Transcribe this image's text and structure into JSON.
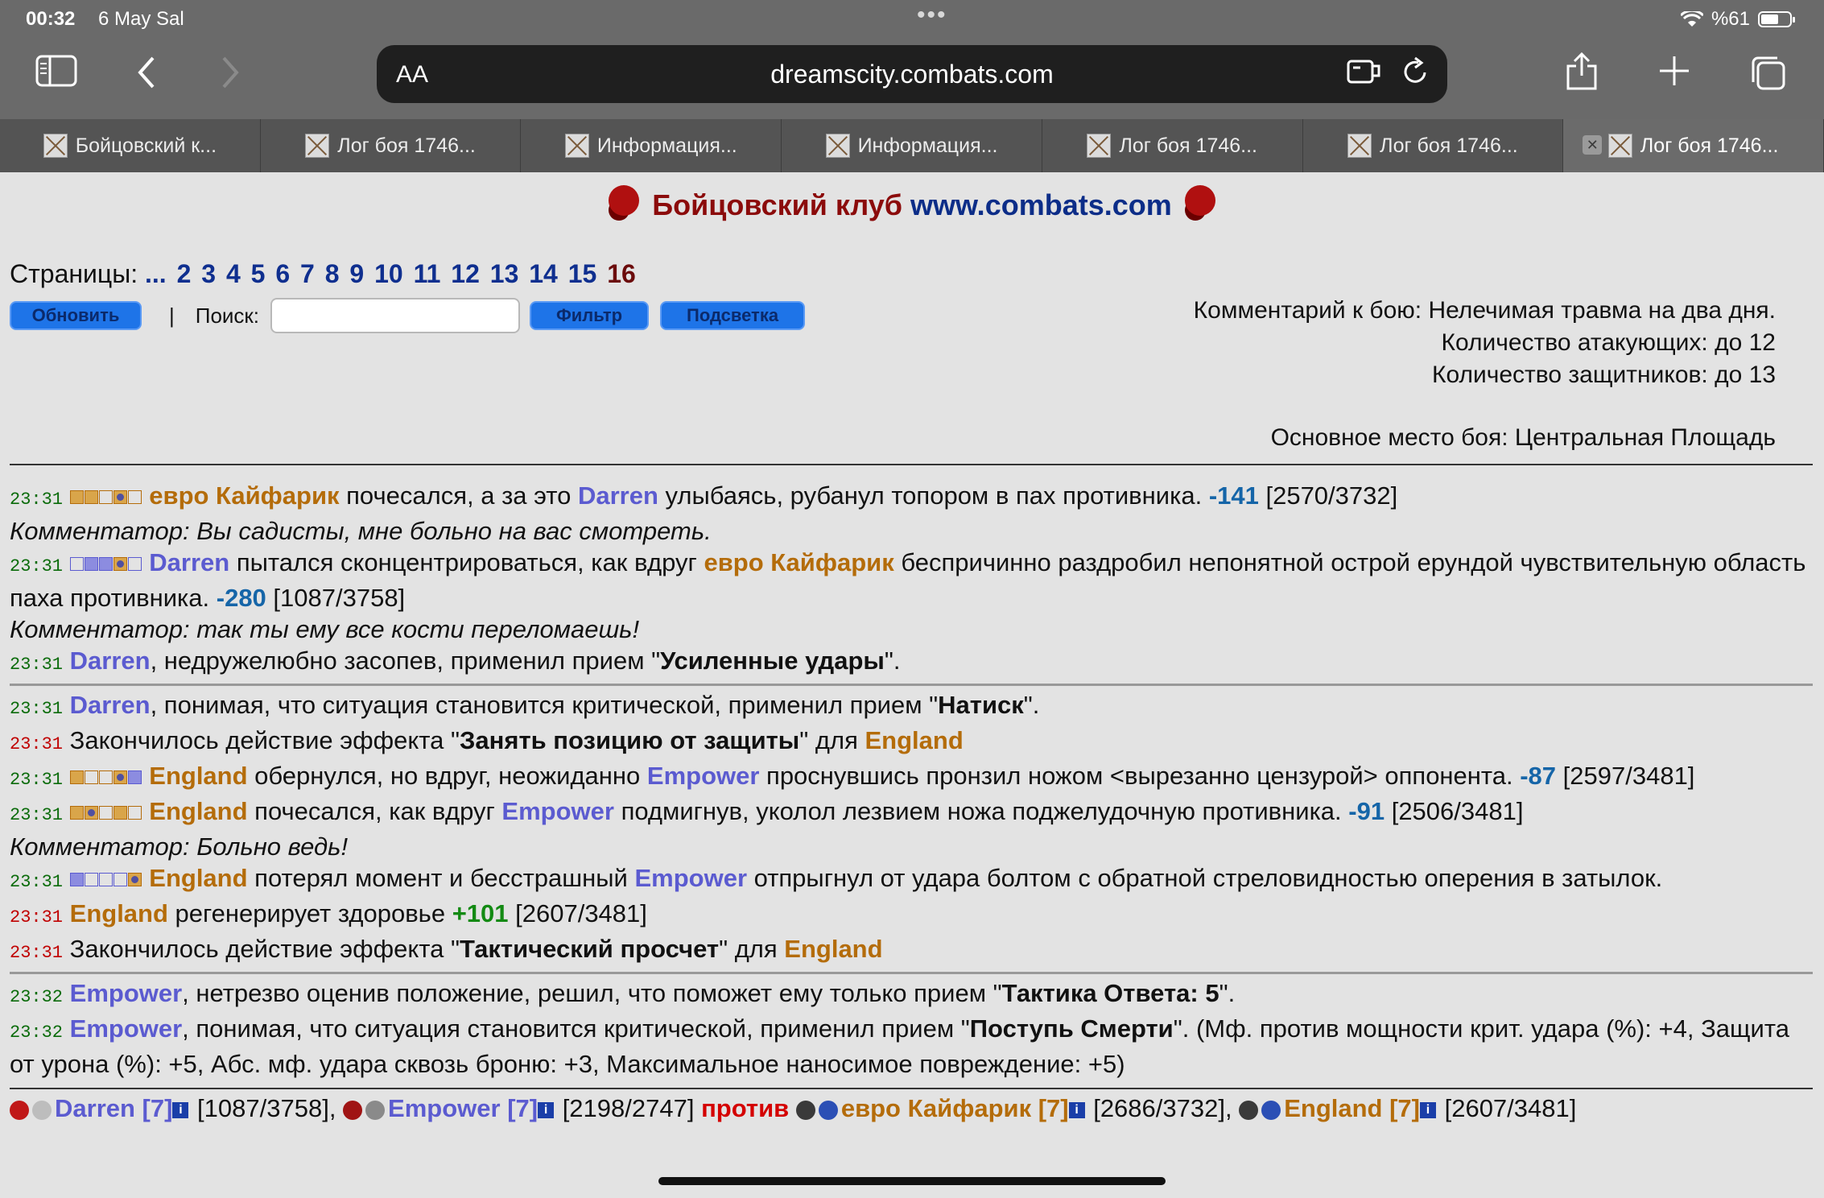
{
  "status": {
    "time": "00:32",
    "date": "6 May Sal",
    "battery": "%61",
    "battery_level": 0.61
  },
  "toolbar": {
    "aa": "AA",
    "url": "dreamscity.combats.com"
  },
  "tabs": [
    "Бойцовский к...",
    "Лог боя 1746...",
    "Информация...",
    "Информация...",
    "Лог боя 1746...",
    "Лог боя 1746...",
    "Лог боя 1746..."
  ],
  "header": {
    "club": "Бойцовский клуб",
    "site": "www.combats.com"
  },
  "pages": {
    "label": "Страницы:",
    "items": [
      "...",
      "2",
      "3",
      "4",
      "5",
      "6",
      "7",
      "8",
      "9",
      "10",
      "11",
      "12",
      "13",
      "14",
      "15"
    ],
    "current": "16"
  },
  "controls": {
    "refresh": "Обновить",
    "divider": "|",
    "search_label": "Поиск:",
    "filter": "Фильтр",
    "highlight": "Подсветка"
  },
  "meta": {
    "comment": "Комментарий к бою: Нелечимая травма на два дня.",
    "attackers": "Количество атакующих: до 12",
    "defenders": "Количество защитников: до 13",
    "location": "Основное место боя: Центральная Площадь"
  },
  "log": {
    "l1": {
      "time": "23:31",
      "a": "евро Кайфарик",
      "t1": " почесался, а за это ",
      "b": "Darren",
      "t2": " улыбаясь, рубанул топором в пах противника. ",
      "dmg": "-141",
      "hp": " [2570/3732]"
    },
    "c1": "Комментатор: Вы садисты, мне больно на вас смотреть.",
    "l2": {
      "time": "23:31",
      "a": "Darren",
      "t1": " пытался сконцентрироваться, как вдруг ",
      "b": "евро Кайфарик",
      "t2": " беспричинно раздробил непонятной острой ерундой чувствительную область паха противника. ",
      "dmg": "-280",
      "hp": " [1087/3758]"
    },
    "c2": "Комментатор: так ты ему все кости переломаешь!",
    "l3": {
      "time": "23:31",
      "a": "Darren",
      "t1": ", недружелюбно засопев, применил прием \"",
      "skill": "Усиленные удары",
      "t2": "\"."
    },
    "l4": {
      "time": "23:31",
      "a": "Darren",
      "t1": ", понимая, что ситуация становится критической, применил прием \"",
      "skill": "Натиск",
      "t2": "\"."
    },
    "l5": {
      "time": "23:31",
      "t1": "Закончилось действие эффекта \"",
      "skill": "Занять позицию от защиты",
      "t2": "\" для ",
      "a": "England"
    },
    "l6": {
      "time": "23:31",
      "a": "England",
      "t1": " обернулся, но вдруг, неожиданно ",
      "b": "Empower",
      "t2": " проснувшись пронзил ножом <вырезанно цензурой> оппонента. ",
      "dmg": "-87",
      "hp": " [2597/3481]"
    },
    "l7": {
      "time": "23:31",
      "a": "England",
      "t1": " почесался, как вдруг ",
      "b": "Empower",
      "t2": " подмигнув, уколол лезвием ножа поджелудочную противника. ",
      "dmg": "-91",
      "hp": " [2506/3481]"
    },
    "c3": "Комментатор: Больно ведь!",
    "l8": {
      "time": "23:31",
      "a": "England",
      "t1": " потерял момент и бесстрашный ",
      "b": "Empower",
      "t2": " отпрыгнул от удара болтом с обратной стреловидностью оперения в затылок."
    },
    "l9": {
      "time": "23:31",
      "a": "England",
      "t1": " регенерирует здоровье ",
      "heal": "+101",
      "hp": " [2607/3481]"
    },
    "l10": {
      "time": "23:31",
      "t1": "Закончилось действие эффекта \"",
      "skill": "Тактический просчет",
      "t2": "\" для ",
      "a": "England"
    },
    "l11": {
      "time": "23:32",
      "a": "Empower",
      "t1": ", нетрезво оценив положение, решил, что поможет ему только прием \"",
      "skill": "Тактика Ответа: 5",
      "t2": "\"."
    },
    "l12": {
      "time": "23:32",
      "a": "Empower",
      "t1": ", понимая, что ситуация становится критической, применил прием \"",
      "skill": "Поступь Смерти",
      "t2": "\". (Мф. против мощности крит. удара (%): +4, Защита от урона (%): +5, Абс. мф. удара сквозь броню: +3, Максимальное наносимое повреждение: +5)"
    }
  },
  "summary": {
    "p1": "Darren [7]",
    "p1hp": " [1087/3758], ",
    "p2": "Empower [7]",
    "p2hp": " [2198/2747] ",
    "vs": "против",
    "p3": "евро Кайфарик [7]",
    "p3hp": " [2686/3732], ",
    "p4": "England [7]",
    "p4hp": " [2607/3481]",
    "info": "i"
  }
}
